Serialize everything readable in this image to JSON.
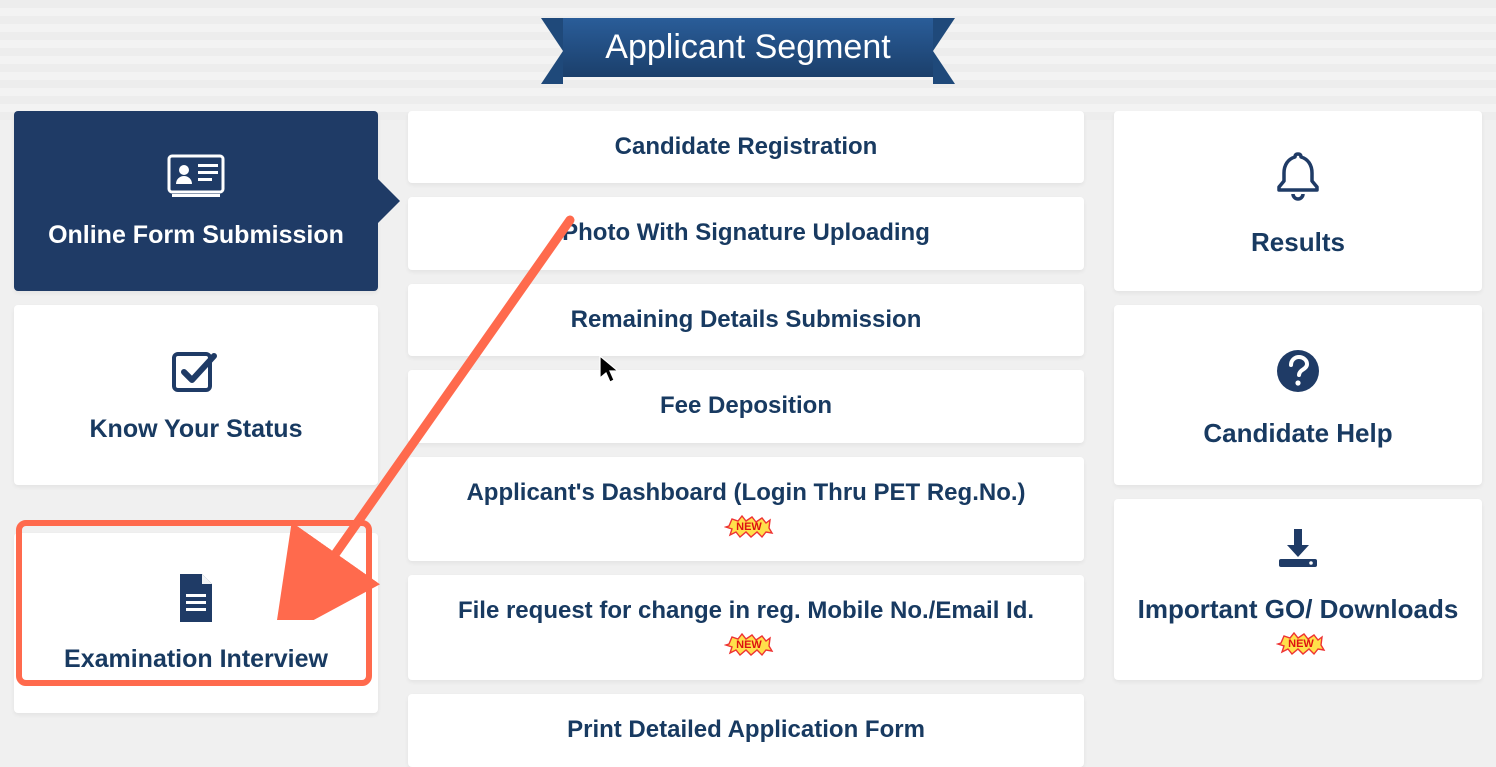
{
  "header": {
    "title": "Applicant Segment"
  },
  "sidebar": {
    "items": [
      {
        "label": "Online Form Submission",
        "icon": "id-card-icon",
        "active": true
      },
      {
        "label": "Know Your Status",
        "icon": "check-icon"
      },
      {
        "label": "Examination Interview",
        "icon": "document-icon"
      }
    ]
  },
  "main": {
    "items": [
      {
        "label": "Candidate Registration",
        "new": false
      },
      {
        "label": "Photo With Signature Uploading",
        "new": false
      },
      {
        "label": "Remaining Details Submission",
        "new": false
      },
      {
        "label": "Fee Deposition",
        "new": false
      },
      {
        "label": "Applicant's Dashboard (Login Thru PET Reg.No.)",
        "new": true
      },
      {
        "label": "File request for change in reg. Mobile No./Email Id.",
        "new": true
      },
      {
        "label": "Print Detailed Application Form",
        "new": false
      }
    ]
  },
  "right": {
    "items": [
      {
        "label": "Results",
        "icon": "bell-icon",
        "new": false
      },
      {
        "label": "Candidate Help",
        "icon": "question-icon",
        "new": false
      },
      {
        "label": "Important GO/ Downloads",
        "icon": "download-icon",
        "new": true
      }
    ]
  },
  "annotation": {
    "highlight_target": "sidebar.items.2",
    "arrow_from": "main.items.1",
    "cursor_near": "main.items.3"
  },
  "colors": {
    "primary": "#1f3b66",
    "text": "#183a61",
    "highlight": "#ff6a4d"
  }
}
